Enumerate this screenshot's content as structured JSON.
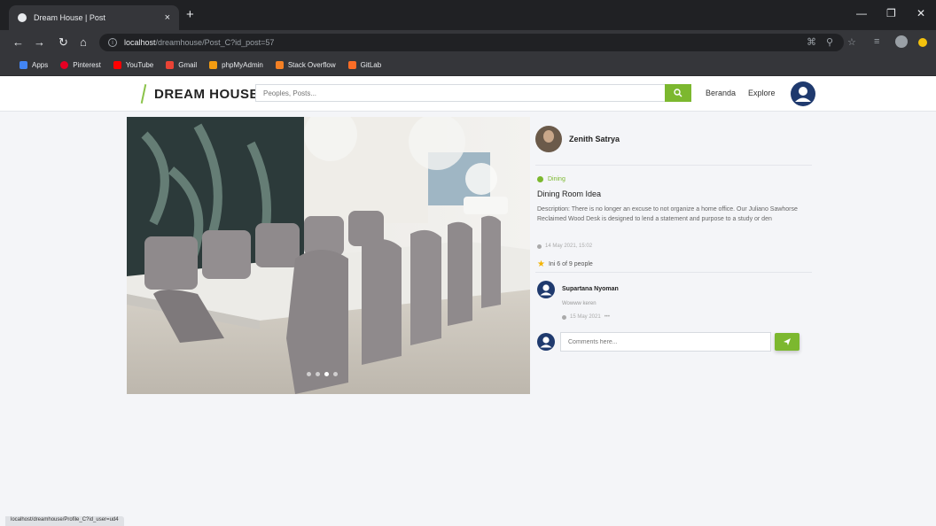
{
  "browser": {
    "tab_title": "Dream House | Post",
    "tab_close": "×",
    "new_tab": "+",
    "url_host": "localhost",
    "url_path": "/dreamhouse/Post_C?id_post=57",
    "bookmarks": [
      {
        "label": "Apps",
        "color": "#4285f4"
      },
      {
        "label": "Pinterest",
        "color": "#e60023"
      },
      {
        "label": "YouTube",
        "color": "#ff0000"
      },
      {
        "label": "Gmail",
        "color": "#ea4335"
      },
      {
        "label": "phpMyAdmin",
        "color": "#f39c12"
      },
      {
        "label": "Stack Overflow",
        "color": "#f48024"
      },
      {
        "label": "GitLab",
        "color": "#fc6d26"
      }
    ],
    "status_url": "localhost/dreamhouse/Profile_C?id_user=ud4"
  },
  "header": {
    "logo_text": "DREAM HOUSE",
    "search_placeholder": "Peoples, Posts...",
    "nav": [
      "Beranda",
      "Explore"
    ]
  },
  "post": {
    "author": "Zenith Satrya",
    "category": "Dining",
    "title": "Dining Room Idea",
    "description": "Description: There is no longer an excuse to not organize a home office. Our Juliano Sawhorse Reclaimed Wood Desk is designed to lend a statement and purpose to a study or den",
    "date": "14 May 2021, 15:02",
    "likes": "Ini 6 of 9 people",
    "slides": 4,
    "active_slide": 2
  },
  "comment": {
    "author": "Supartana Nyoman",
    "text": "Wowww keren",
    "date": "15 May 2021",
    "more": "•••"
  },
  "comment_form": {
    "placeholder": "Comments here..."
  },
  "colors": {
    "accent": "#7cb82f",
    "avatar": "#1f3a6e"
  }
}
